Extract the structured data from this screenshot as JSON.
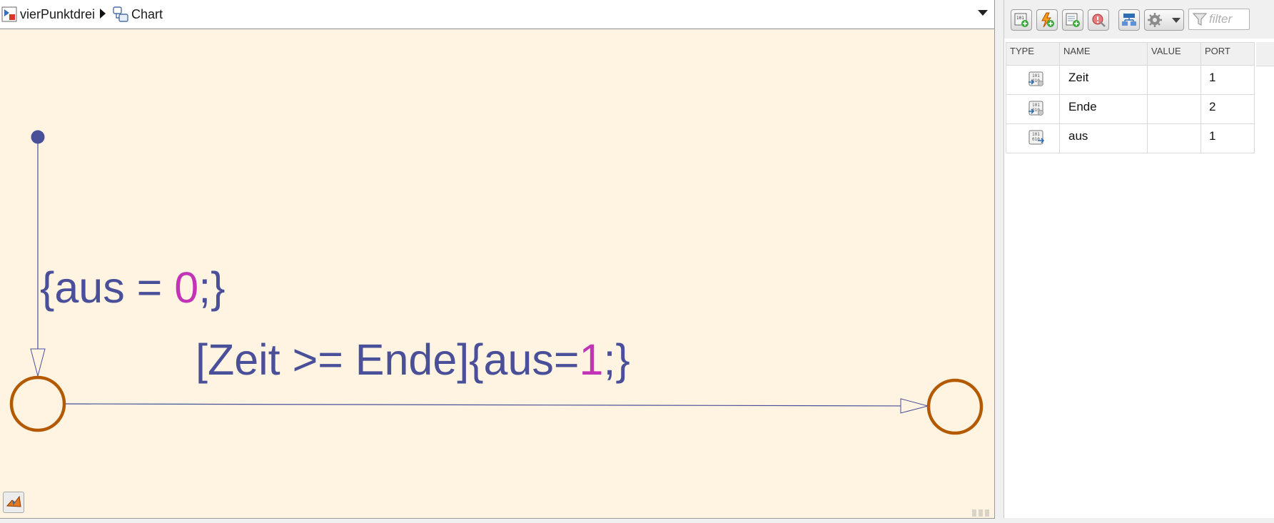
{
  "breadcrumb": {
    "model": "vierPunktdrei",
    "chart": "Chart"
  },
  "chart": {
    "default_transition_action": {
      "prefix": "{aus = ",
      "number": "0",
      "suffix": ";}"
    },
    "transition_label": {
      "prefix": "[Zeit >= Ende]{aus=",
      "number": "1",
      "suffix": ";}"
    },
    "colors": {
      "canvas": "#fff4e1",
      "junction": "#b35a00",
      "transition": "#4a4f99",
      "label_text": "#4a4f99",
      "label_number": "#c233b8"
    }
  },
  "toolbar": {
    "icons": [
      "add-data-icon",
      "add-event-icon",
      "add-message-icon",
      "resolve-undefined-icon",
      "model-hierarchy-icon",
      "settings-icon"
    ],
    "filter_placeholder": "filter"
  },
  "symbols_table": {
    "columns": [
      "TYPE",
      "NAME",
      "VALUE",
      "PORT"
    ],
    "rows": [
      {
        "type_icon": "input-data-icon",
        "name": "Zeit",
        "value": "",
        "port": "1"
      },
      {
        "type_icon": "input-data-icon",
        "name": "Ende",
        "value": "",
        "port": "2"
      },
      {
        "type_icon": "output-data-icon",
        "name": "aus",
        "value": "",
        "port": "1"
      }
    ]
  }
}
